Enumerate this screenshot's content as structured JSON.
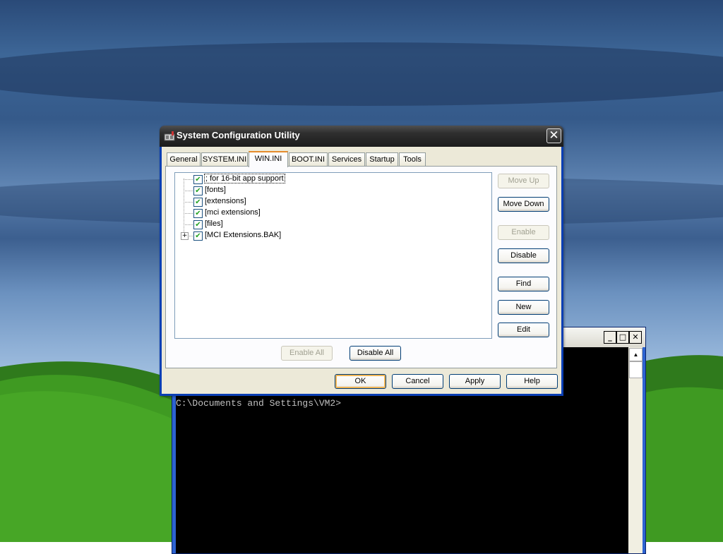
{
  "window": {
    "title": "System Configuration Utility",
    "close_glyph": "✕"
  },
  "tabs": [
    {
      "label": "General"
    },
    {
      "label": "SYSTEM.INI"
    },
    {
      "label": "WIN.INI",
      "active": true
    },
    {
      "label": "BOOT.INI"
    },
    {
      "label": "Services"
    },
    {
      "label": "Startup"
    },
    {
      "label": "Tools"
    }
  ],
  "tree": {
    "items": [
      {
        "label": "; for 16-bit app support",
        "checked": true,
        "selected": true
      },
      {
        "label": "[fonts]",
        "checked": true
      },
      {
        "label": "[extensions]",
        "checked": true
      },
      {
        "label": "[mci extensions]",
        "checked": true
      },
      {
        "label": "[files]",
        "checked": true
      },
      {
        "label": "[MCI Extensions.BAK]",
        "checked": true,
        "expandable": true
      }
    ],
    "check_glyph": "✔",
    "expand_glyph": "+"
  },
  "side_buttons": {
    "move_up": "Move Up",
    "move_down": "Move Down",
    "enable": "Enable",
    "disable": "Disable",
    "find": "Find",
    "new": "New",
    "edit": "Edit"
  },
  "bottom_buttons": {
    "enable_all": "Enable All",
    "disable_all": "Disable All"
  },
  "footer_buttons": {
    "ok": "OK",
    "cancel": "Cancel",
    "apply": "Apply",
    "help": "Help"
  },
  "console": {
    "prompt": "C:\\Documents and Settings\\VM2>",
    "minimize_glyph": "_",
    "maximize_glyph": "□",
    "close_glyph": "✕",
    "scroll_up_glyph": "▲"
  },
  "colors": {
    "titlebar": "#1c1c1c",
    "dialog_face": "#ece9d8",
    "tab_accent": "#e68b2c",
    "default_button_glow": "#f0b556",
    "console_bg": "#000000"
  }
}
